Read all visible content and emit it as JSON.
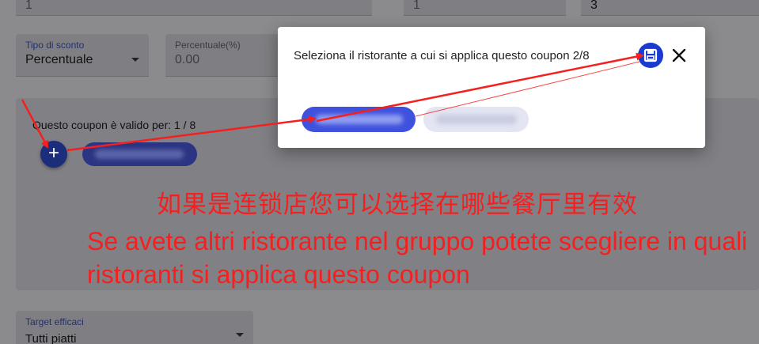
{
  "form": {
    "top_values": [
      "1",
      "1",
      "3"
    ],
    "discount_type": {
      "label": "Tipo di sconto",
      "value": "Percentuale"
    },
    "percentage": {
      "label": "Percentuale(%)",
      "value": "0.00"
    },
    "valid_for": "Questo coupon è valido per: 1 / 8",
    "target": {
      "label": "Target efficaci",
      "value": "Tutti piatti"
    }
  },
  "dialog": {
    "title": "Seleziona il ristorante a cui si applica questo coupon 2/8"
  },
  "annotations": {
    "chinese": "如果是连锁店您可以选择在哪些餐厅里有效",
    "italian": "Se avete altri ristorante nel gruppo potete scegliere in quali ristoranti si applica questo coupon"
  },
  "colors": {
    "accent": "#1a3bd0",
    "annotation": "#f51f1f",
    "chip_selected": "#3f52dd",
    "chip_unselected": "#e3e5f3"
  },
  "icons": [
    "plus-icon",
    "save-icon",
    "close-icon"
  ]
}
